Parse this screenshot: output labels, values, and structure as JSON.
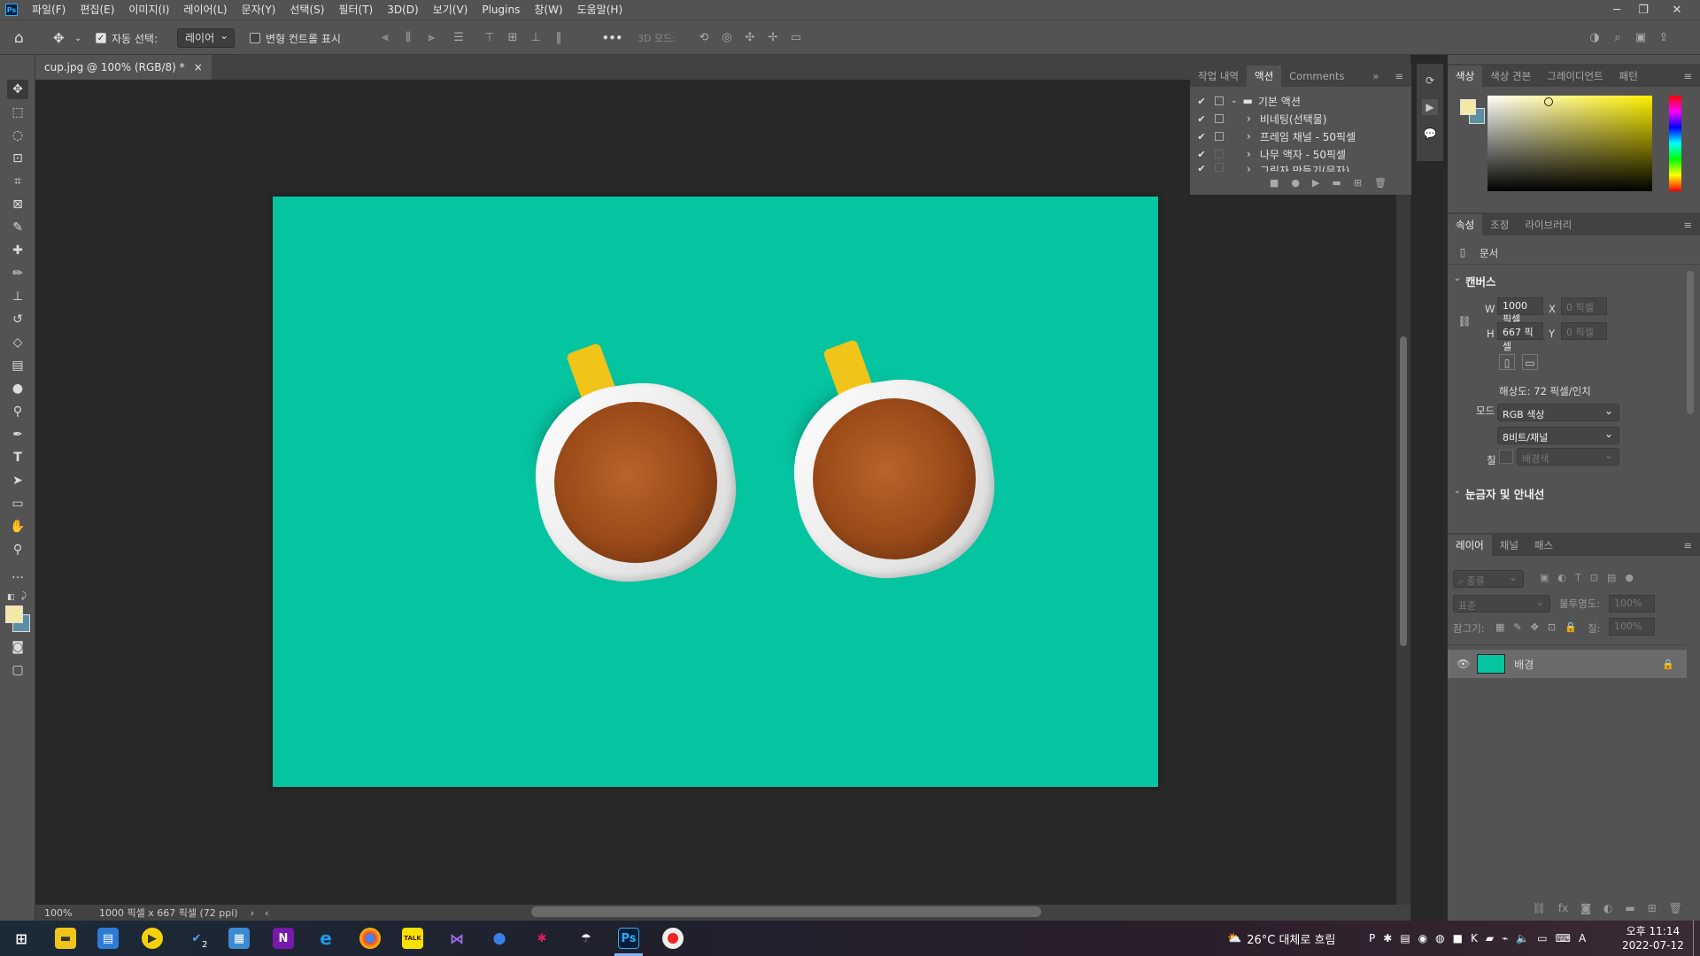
{
  "menu": {
    "logo": "Ps",
    "items": [
      "파일(F)",
      "편집(E)",
      "이미지(I)",
      "레이어(L)",
      "문자(Y)",
      "선택(S)",
      "필터(T)",
      "3D(D)",
      "보기(V)",
      "Plugins",
      "창(W)",
      "도움말(H)"
    ]
  },
  "options": {
    "auto_select_label": "자동 선택:",
    "auto_select_value": "레이어",
    "transform_label": "변형 컨트롤 표시",
    "mode_3d": "3D 모드:",
    "more": "•••"
  },
  "document": {
    "tab_title": "cup.jpg @ 100% (RGB/8) *",
    "zoom": "100%",
    "info": "1000 픽셀 x 667 픽셀 (72 ppi)",
    "canvas_color": "#05c4a0"
  },
  "actions_panel": {
    "tabs": [
      "작업 내역",
      "액션",
      "Comments"
    ],
    "rows": [
      {
        "label": "기본 액션",
        "type": "folder"
      },
      {
        "label": "비네팅(선택물)",
        "type": "action"
      },
      {
        "label": "프레임 채널 - 50픽셀",
        "type": "action"
      },
      {
        "label": "나무 액자 - 50픽셀",
        "type": "action"
      },
      {
        "label": "그림자 만들기(문자)",
        "type": "action"
      }
    ]
  },
  "color_panel": {
    "tabs": [
      "색상",
      "색상 견본",
      "그레이디언트",
      "패턴"
    ],
    "foreground": "#f3e9a6",
    "background": "#5d8fa3",
    "hue": "#fff000"
  },
  "properties": {
    "tabs": [
      "속성",
      "조정",
      "라이브러리"
    ],
    "doc_label": "문서",
    "canvas_section": "캔버스",
    "w_label": "W",
    "w_value": "1000 픽셀",
    "h_label": "H",
    "h_value": "667 픽셀",
    "x_label": "X",
    "x_placeholder": "0 픽셀",
    "y_label": "Y",
    "y_placeholder": "0 픽셀",
    "resolution": "해상도: 72 픽셀/인치",
    "mode_label": "모드",
    "mode_value": "RGB 색상",
    "depth_value": "8비트/채널",
    "fill_label": "칠",
    "fill_value": "배경색",
    "rulers_section": "눈금자 및 안내선"
  },
  "layers": {
    "tabs": [
      "레이어",
      "채널",
      "패스"
    ],
    "search_placeholder": "종류",
    "blend_mode": "표준",
    "opacity_label": "불투명도:",
    "opacity_value": "100%",
    "lock_label": "잠그기:",
    "fill_label": "칠:",
    "fill_value": "100%",
    "items": [
      {
        "name": "배경",
        "visible": true,
        "locked": true
      }
    ]
  },
  "taskbar": {
    "weather": "26°C 대체로 흐림",
    "time": "오후 11:14",
    "date": "2022-07-12",
    "ime": "A",
    "badge": "2",
    "app_labels": {
      "onenote": "N",
      "kakao": "TALK",
      "photoshop": "Ps",
      "ie": "e"
    }
  }
}
